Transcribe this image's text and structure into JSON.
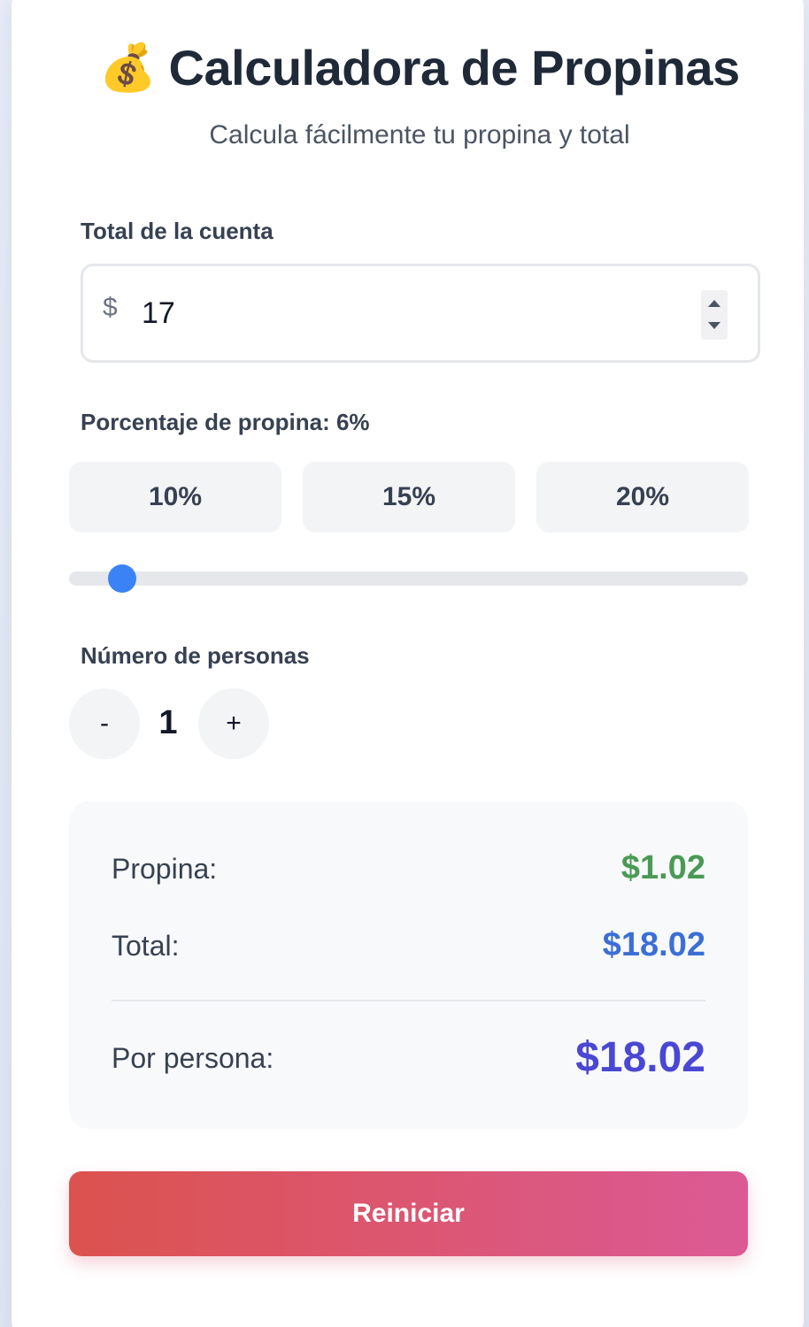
{
  "header": {
    "icon": "money-bag-icon",
    "emoji": "💰",
    "title": "Calculadora de Propinas",
    "subtitle": "Calcula fácilmente tu propina y total"
  },
  "bill": {
    "label": "Total de la cuenta",
    "currency_symbol": "$",
    "value": "17"
  },
  "tip": {
    "label": "Porcentaje de propina: 6%",
    "percent": 6,
    "slider_min": 0,
    "slider_max": 100,
    "presets": [
      "10%",
      "15%",
      "20%"
    ],
    "accent": "#3b82f6"
  },
  "people": {
    "label": "Número de personas",
    "decrement_label": "-",
    "count": "1",
    "increment_label": "+"
  },
  "results": {
    "tip_label": "Propina:",
    "tip_value": "$1.02",
    "tip_color": "#4a9a55",
    "total_label": "Total:",
    "total_value": "$18.02",
    "total_color": "#3b6fd6",
    "per_person_label": "Por persona:",
    "per_person_value": "$18.02",
    "per_person_color": "#4a47d4"
  },
  "reset": {
    "label": "Reiniciar"
  }
}
